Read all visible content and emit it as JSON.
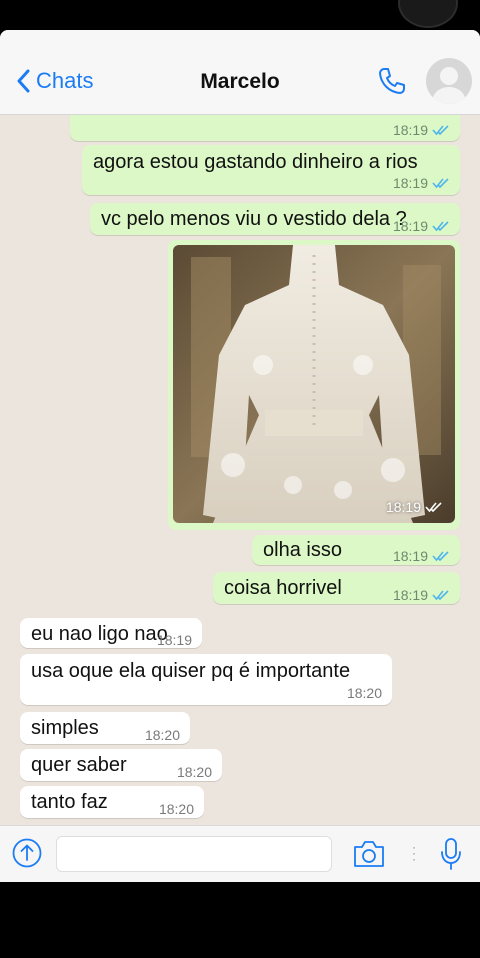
{
  "header": {
    "back_label": "Chats",
    "contact_name": "Marcelo"
  },
  "messages": [
    {
      "dir": "out",
      "text": "",
      "time": "18:19",
      "read": true
    },
    {
      "dir": "out",
      "text": "agora estou gastando dinheiro a rios",
      "time": "18:19",
      "read": true
    },
    {
      "dir": "out",
      "text": "vc pelo menos viu o vestido dela ?",
      "time": "18:19",
      "read": true
    },
    {
      "dir": "out",
      "type": "image",
      "alt": "vestido",
      "time": "18:19",
      "read": true
    },
    {
      "dir": "out",
      "text": "olha isso",
      "time": "18:19",
      "read": true
    },
    {
      "dir": "out",
      "text": "coisa horrivel",
      "time": "18:19",
      "read": true
    },
    {
      "dir": "in",
      "text": "eu nao ligo nao",
      "time": "18:19"
    },
    {
      "dir": "in",
      "text": "usa oque ela quiser pq é importante",
      "time": "18:20"
    },
    {
      "dir": "in",
      "text": "simples",
      "time": "18:20"
    },
    {
      "dir": "in",
      "text": "quer saber",
      "time": "18:20"
    },
    {
      "dir": "in",
      "text": "tanto faz",
      "time": "18:20"
    }
  ],
  "input": {
    "placeholder": ""
  },
  "colors": {
    "outgoing_bubble": "#dcf8c6",
    "incoming_bubble": "#ffffff",
    "chat_background": "#ece5dd",
    "accent": "#1b7cf3",
    "read_tick": "#4fb6ec"
  },
  "icons": [
    "chevron-left-icon",
    "phone-icon",
    "avatar",
    "double-tick-icon",
    "plus-icon",
    "camera-icon",
    "more-dots-icon",
    "microphone-icon"
  ]
}
